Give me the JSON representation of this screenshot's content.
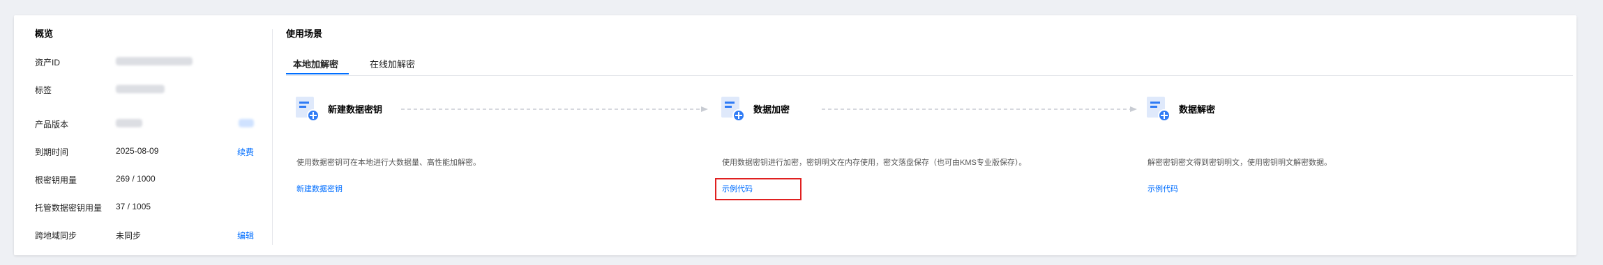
{
  "overview": {
    "title": "概览",
    "rows": [
      {
        "label": "资产ID",
        "value": "",
        "link": ""
      },
      {
        "label": "标签",
        "value": "",
        "link": ""
      },
      {
        "label": "产品版本",
        "value": "",
        "link": ""
      },
      {
        "label": "到期时间",
        "value": "2025-08-09",
        "link": "续费"
      },
      {
        "label": "根密钥用量",
        "value": "269 / 1000",
        "link": ""
      },
      {
        "label": "托管数据密钥用量",
        "value": "37 / 1005",
        "link": ""
      },
      {
        "label": "跨地域同步",
        "value": "未同步",
        "link": "编辑"
      }
    ]
  },
  "scene": {
    "title": "使用场景",
    "tabs": [
      {
        "label": "本地加解密",
        "active": true
      },
      {
        "label": "在线加解密",
        "active": false
      }
    ],
    "steps": [
      {
        "icon": "document-add-icon",
        "title": "新建数据密钥",
        "desc": "使用数据密钥可在本地进行大数据量、高性能加解密。",
        "link": "新建数据密钥"
      },
      {
        "icon": "document-add-icon",
        "title": "数据加密",
        "desc": "使用数据密钥进行加密，密钥明文在内存使用，密文落盘保存（也可由KMS专业版保存）。",
        "link": "示例代码"
      },
      {
        "icon": "document-add-icon",
        "title": "数据解密",
        "desc": "解密密钥密文得到密钥明文，使用密钥明文解密数据。",
        "link": "示例代码"
      }
    ]
  },
  "colors": {
    "accent": "#006eff",
    "highlight": "#e02020",
    "icon_blue": "#2f7bf5",
    "icon_light": "#dfe9fb"
  }
}
